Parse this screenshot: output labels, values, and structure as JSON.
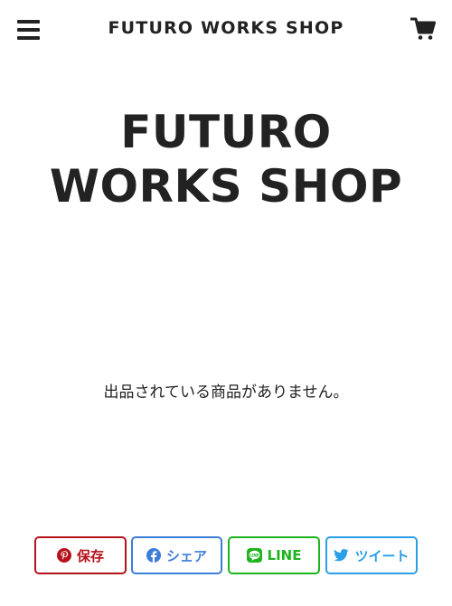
{
  "header": {
    "title": "FUTURO WORKS SHOP",
    "menu_icon": "hamburger-menu-icon",
    "cart_icon": "shopping-cart-icon"
  },
  "hero": {
    "title": "FUTURO WORKS SHOP"
  },
  "main": {
    "empty_message": "出品されている商品がありません。"
  },
  "share": {
    "buttons": [
      {
        "label": "保存",
        "icon": "pinterest-icon",
        "color": "#b5121b"
      },
      {
        "label": "シェア",
        "icon": "facebook-icon",
        "color": "#3b7dd8"
      },
      {
        "label": "LINE",
        "icon": "line-icon",
        "color": "#1db41d"
      },
      {
        "label": "ツイート",
        "icon": "twitter-icon",
        "color": "#2a9ee6"
      }
    ]
  },
  "colors": {
    "text": "#222222",
    "background": "#ffffff"
  }
}
